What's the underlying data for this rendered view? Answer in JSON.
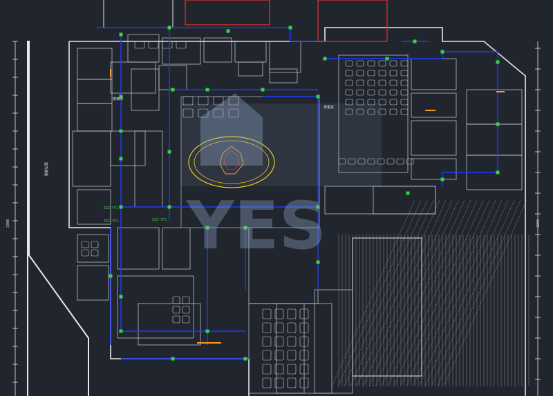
{
  "drawing": {
    "background": "#21252e",
    "colors": {
      "wall": "#e8e8e8",
      "fixture": "#cfd3d9",
      "pipe": "#1f3cff",
      "node": "#37d43f",
      "fire_room": "#d62b2b",
      "accent_orange": "#ff9a1f",
      "accent_yellow": "#ffd200",
      "hatch": "#8a8f98",
      "watermark": "rgba(150,175,205,0.35)"
    },
    "labels": {
      "corridor_left": "室内通道",
      "room_a": "楼梯间",
      "room_b": "男更衣",
      "pipe_tag_1": "ZSZ-YF1",
      "pipe_tag_2": "ZSZ-YF2",
      "pipe_tag_3": "ZSZ-YF3",
      "dim_left": "3300",
      "dim_right": "4200"
    },
    "watermark_text": "YES"
  }
}
